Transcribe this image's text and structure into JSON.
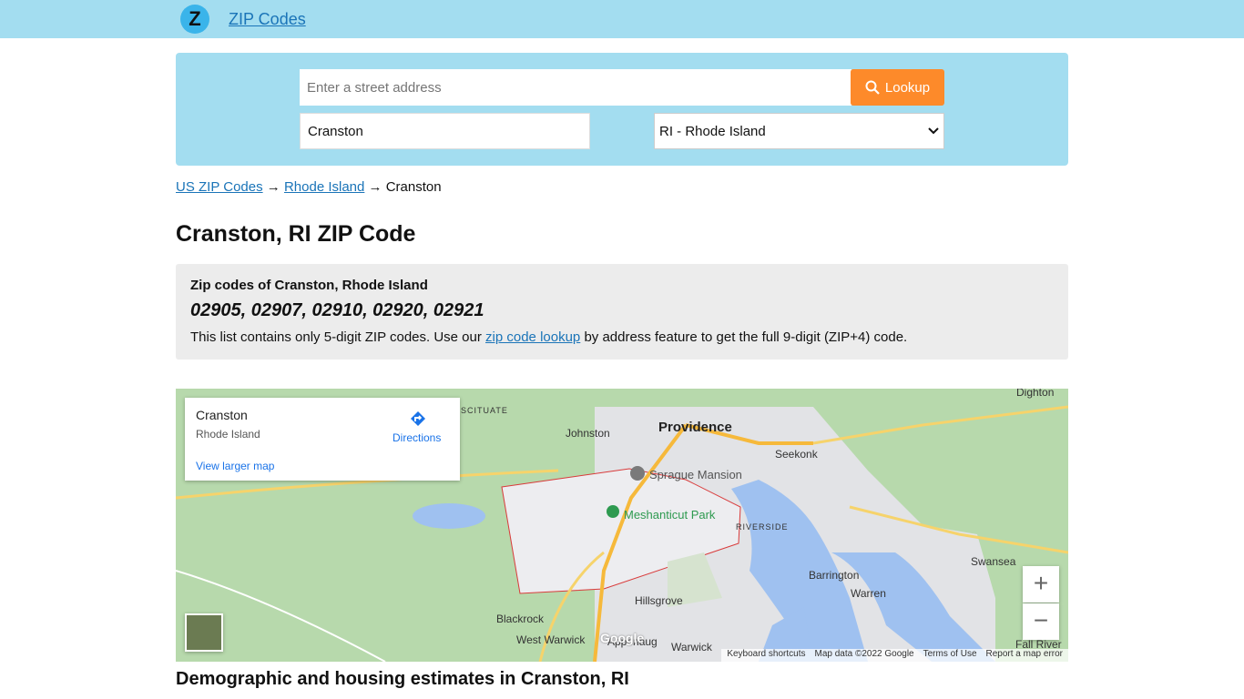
{
  "header": {
    "logo_letter": "Z",
    "site_name": "ZIP Codes"
  },
  "search": {
    "address_placeholder": "Enter a street address",
    "lookup_label": "Lookup",
    "city_value": "Cranston",
    "state_value": "RI - Rhode Island"
  },
  "breadcrumb": {
    "root": "US ZIP Codes",
    "sep1": "→",
    "state": "Rhode Island",
    "sep2": "→",
    "city": "Cranston"
  },
  "page_title": "Cranston, RI ZIP Code",
  "zip_section": {
    "subtitle": "Zip codes of Cranston, Rhode Island",
    "codes": "02905, 02907, 02910, 02920, 02921",
    "note_before": "This list contains only 5-digit ZIP codes. Use our ",
    "note_link": "zip code lookup",
    "note_after": " by address feature to get the full 9-digit (ZIP+4) code."
  },
  "map": {
    "card_title": "Cranston",
    "card_subtitle": "Rhode Island",
    "directions_label": "Directions",
    "view_larger": "View larger map",
    "places": {
      "providence": "Providence",
      "sprague": "Sprague Mansion",
      "meshanticut": "Meshanticut Park",
      "johnston": "Johnston",
      "seekonk": "Seekonk",
      "riverside": "RIVERSIDE",
      "barrington": "Barrington",
      "warren": "Warren",
      "swansea": "Swansea",
      "hillsgrove": "Hillsgrove",
      "blackrock": "Blackrock",
      "westwarwick": "West Warwick",
      "apponaug": "Apponaug",
      "warwick": "Warwick",
      "dighton": "Dighton",
      "fallriver": "Fall River",
      "scituate": "SCITUATE"
    },
    "zoom_in": "+",
    "zoom_out": "−",
    "google": "Google",
    "footer": {
      "shortcuts": "Keyboard shortcuts",
      "mapdata": "Map data ©2022 Google",
      "terms": "Terms of Use",
      "report": "Report a map error"
    }
  },
  "demographics_title": "Demographic and housing estimates in Cranston, RI",
  "colors": {
    "topbar": "#a3ddf0",
    "link": "#1a74b8",
    "lookup_button": "#fd8a2a",
    "zip_box": "#ececec"
  },
  "icons": {
    "lookup": "search-icon",
    "directions": "directions-icon",
    "state_select": "chevron-down-icon"
  }
}
